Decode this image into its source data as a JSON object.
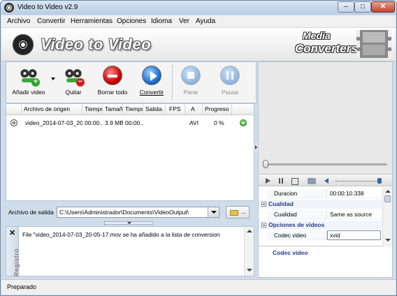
{
  "window": {
    "title": "Video to Video v2.9"
  },
  "menu": [
    "Archivo",
    "Convertir",
    "Herramientas",
    "Opciones",
    "Idioma",
    "Ver",
    "Ayuda"
  ],
  "banner": {
    "title": "Video to Video",
    "brand_top": "Media",
    "brand_bottom": "Converters"
  },
  "toolbar": {
    "add_label": "Añadir video",
    "remove_label": "Quitar",
    "clear_label": "Borrar todo",
    "convert_label": "Convertir",
    "stop_label": "Parar",
    "pause_label": "Pausa"
  },
  "table": {
    "columns": [
      "Archivo de origen",
      "Tiempo",
      "Tamañ",
      "Tiempo",
      "Salida.",
      "FPS",
      "A",
      "Progreso"
    ],
    "rows": [
      {
        "file": "video_2014-07-03_20...",
        "time": "00:00...",
        "size": "3.9 MB",
        "time2": "00:00...",
        "output": "",
        "fps": "",
        "a": "AVI",
        "progress": "0 %"
      }
    ]
  },
  "output": {
    "label": "Archivo de salida",
    "path": "C:\\Users\\Administrador\\Documents\\VideoOutput\\",
    "browse_dots": "..."
  },
  "log": {
    "title": "Registro",
    "close": "✕",
    "message": "File \"video_2014-07-03_20-05-17.mov se ha añadido a la lista de conversion"
  },
  "properties": {
    "duration_name": "Duracion",
    "duration_value": "00:00:10.338",
    "cat_quality": "Cualidad",
    "quality_name": "Cualidad",
    "quality_value": "Same as source",
    "cat_video": "Opciones de videos",
    "codec_name": "Codec video",
    "codec_value": "xvid",
    "description_title": "Codec video"
  },
  "status": {
    "text": "Preparado"
  },
  "icons": {
    "app": "film-reel-icon",
    "add": "film-reel-add-icon",
    "remove": "film-reel-remove-icon",
    "clear": "no-entry-icon",
    "convert": "play-circle-icon",
    "stop": "stop-circle-icon",
    "pause": "pause-circle-icon",
    "done": "check-circle-icon",
    "folder": "folder-icon"
  }
}
